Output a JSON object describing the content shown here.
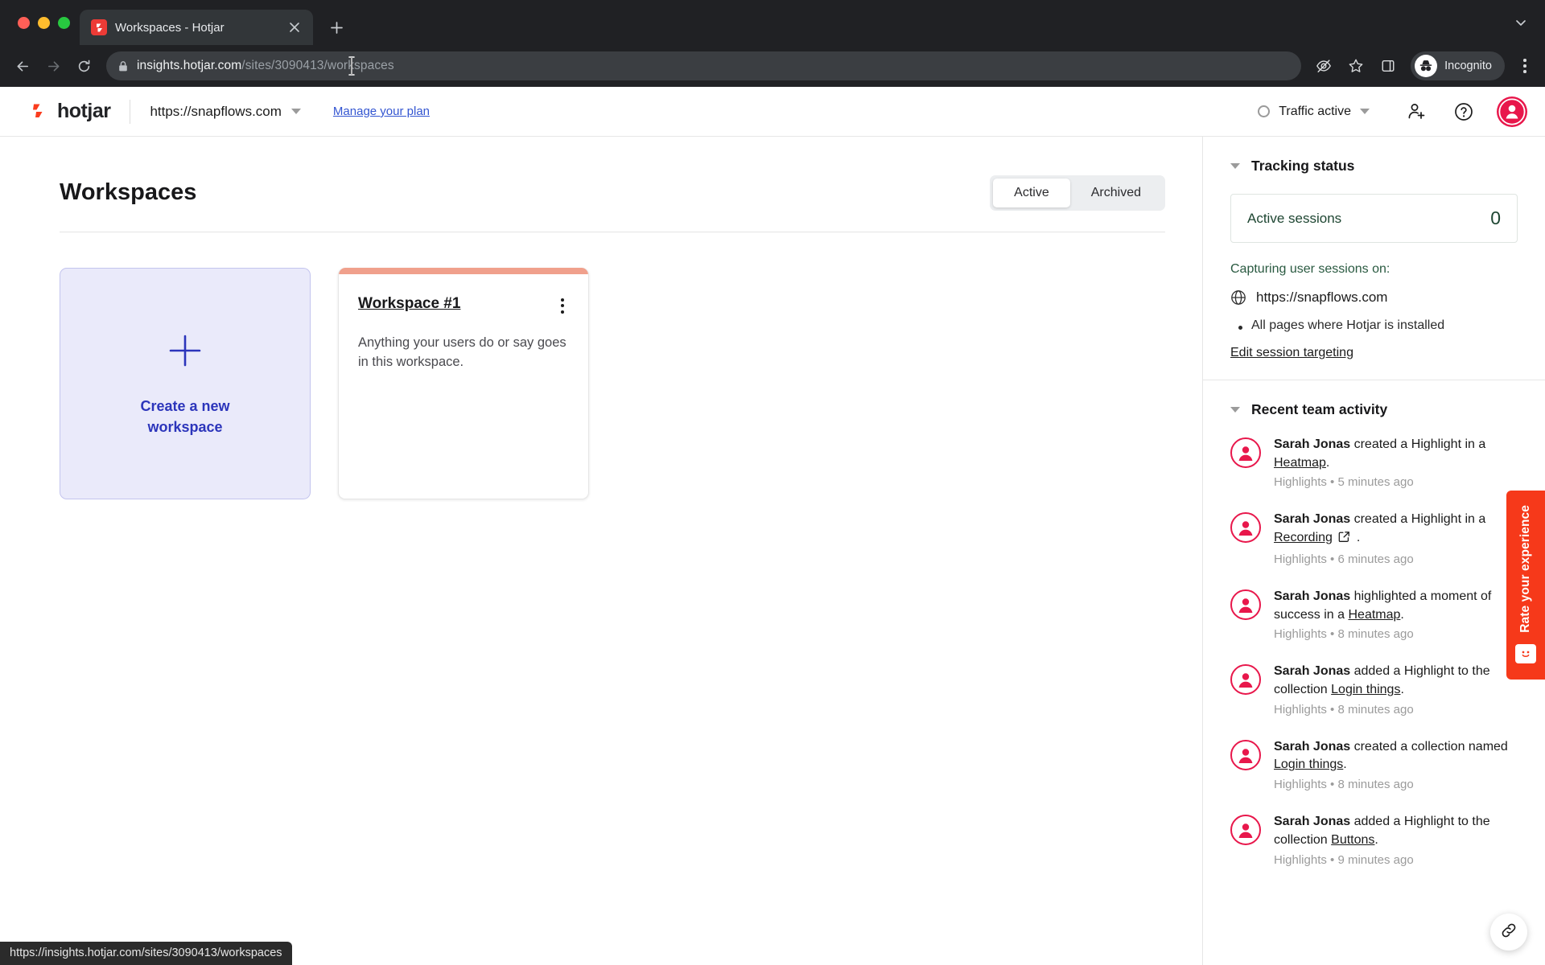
{
  "browser": {
    "tab": {
      "title": "Workspaces - Hotjar",
      "favicon": "hotjar-favicon"
    },
    "new_tab_label": "+",
    "tab_list_chevron": "chevron-down-icon",
    "nav": {
      "back": "back-arrow-icon",
      "forward": "forward-arrow-icon",
      "reload": "reload-icon"
    },
    "omnibox": {
      "lock": "lock-icon",
      "host": "insights.hotjar.com",
      "path": "/sites/3090413/workspaces"
    },
    "toolbar_icons": [
      "eye-slash-icon",
      "star-icon",
      "side-panel-icon"
    ],
    "profile": {
      "label": "Incognito",
      "icon": "incognito-icon"
    },
    "menu": "three-dot-menu-icon"
  },
  "status_bar": {
    "url": "https://insights.hotjar.com/sites/3090413/workspaces"
  },
  "app_header": {
    "logo_text": "hotjar",
    "site_selector": {
      "value": "https://snapflows.com",
      "chevron": "chevron-down-icon"
    },
    "manage_plan_label": "Manage your plan",
    "traffic_status": {
      "label": "Traffic active",
      "chevron": "chevron-down-icon",
      "indicator": "circle-outline-icon"
    },
    "invite_icon": "add-user-icon",
    "help_icon": "question-mark-icon",
    "avatar": "user-avatar"
  },
  "main": {
    "page_title": "Workspaces",
    "segments": [
      {
        "label": "Active",
        "active": true
      },
      {
        "label": "Archived",
        "active": false
      }
    ],
    "create_card": {
      "plus_icon": "plus-icon",
      "label": "Create a new workspace"
    },
    "workspaces": [
      {
        "title": "Workspace #1",
        "description": "Anything your users do or say goes in this workspace.",
        "accent_color": "#f0a08c",
        "menu_icon": "three-dot-menu-icon"
      }
    ]
  },
  "sidebar": {
    "tracking": {
      "title": "Tracking status",
      "caret": "caret-down-icon",
      "active_sessions_label": "Active sessions",
      "active_sessions_count": "0",
      "capturing_label": "Capturing user sessions on:",
      "site_icon": "globe-icon",
      "site_url": "https://snapflows.com",
      "scope_bullet": "All pages where Hotjar is installed",
      "edit_link": "Edit session targeting"
    },
    "activity": {
      "title": "Recent team activity",
      "caret": "caret-down-icon",
      "items": [
        {
          "actor": "Sarah Jonas",
          "action_before": " created a Highlight in a ",
          "link": "Heatmap",
          "external": false,
          "action_after": ".",
          "meta": "Highlights • 5 minutes ago"
        },
        {
          "actor": "Sarah Jonas",
          "action_before": " created a Highlight in a ",
          "link": "Recording",
          "external": true,
          "action_after": ".",
          "meta": "Highlights • 6 minutes ago"
        },
        {
          "actor": "Sarah Jonas",
          "action_before": " highlighted a moment of success in a ",
          "link": "Heatmap",
          "external": false,
          "action_after": ".",
          "meta": "Highlights • 8 minutes ago"
        },
        {
          "actor": "Sarah Jonas",
          "action_before": " added a Highlight to the collection ",
          "link": "Login things",
          "external": false,
          "action_after": ".",
          "meta": "Highlights • 8 minutes ago"
        },
        {
          "actor": "Sarah Jonas",
          "action_before": " created a collection named ",
          "link": "Login things",
          "external": false,
          "action_after": ".",
          "meta": "Highlights • 8 minutes ago"
        },
        {
          "actor": "Sarah Jonas",
          "action_before": " added a Highlight to the collection ",
          "link": "Buttons",
          "external": false,
          "action_after": ".",
          "meta": "Highlights • 9 minutes ago"
        }
      ]
    }
  },
  "rate_widget": {
    "label": "Rate your experience",
    "icon": "smiley-face-icon"
  },
  "float_button": {
    "icon": "link-icon"
  },
  "colors": {
    "brand_red": "#e8174b",
    "hotjar_orange": "#fa3c1e",
    "accent_blue": "#2c35bb",
    "card_accent": "#f0a08c",
    "tracking_green": "#1e4632"
  }
}
